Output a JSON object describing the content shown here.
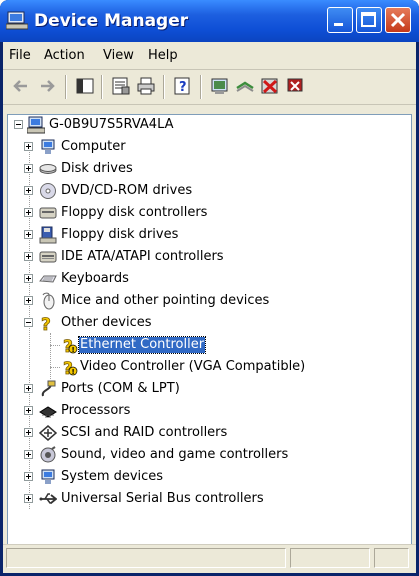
{
  "window": {
    "title": "Device Manager"
  },
  "menu": {
    "file": "File",
    "action": "Action",
    "view": "View",
    "help": "Help"
  },
  "toolbar": {
    "icons": [
      "back-arrow-icon",
      "forward-arrow-icon",
      "console-tree-icon",
      "properties-icon",
      "print-icon",
      "help-icon",
      "scan-hardware-icon",
      "update-driver-icon",
      "disable-device-icon",
      "uninstall-device-icon"
    ]
  },
  "tree": {
    "root": "G-0B9U7S5RVA4LA",
    "items": [
      {
        "label": "Computer",
        "icon": "computer-icon",
        "expanded": false
      },
      {
        "label": "Disk drives",
        "icon": "disk-drive-icon",
        "expanded": false
      },
      {
        "label": "DVD/CD-ROM drives",
        "icon": "cdrom-icon",
        "expanded": false
      },
      {
        "label": "Floppy disk controllers",
        "icon": "floppy-controller-icon",
        "expanded": false
      },
      {
        "label": "Floppy disk drives",
        "icon": "floppy-drive-icon",
        "expanded": false
      },
      {
        "label": "IDE ATA/ATAPI controllers",
        "icon": "ide-controller-icon",
        "expanded": false
      },
      {
        "label": "Keyboards",
        "icon": "keyboard-icon",
        "expanded": false
      },
      {
        "label": "Mice and other pointing devices",
        "icon": "mouse-icon",
        "expanded": false
      },
      {
        "label": "Other devices",
        "icon": "unknown-device-icon",
        "expanded": true
      },
      {
        "label": "Ports (COM & LPT)",
        "icon": "port-icon",
        "expanded": false
      },
      {
        "label": "Processors",
        "icon": "processor-icon",
        "expanded": false
      },
      {
        "label": "SCSI and RAID controllers",
        "icon": "scsi-icon",
        "expanded": false
      },
      {
        "label": "Sound, video and game controllers",
        "icon": "sound-icon",
        "expanded": false
      },
      {
        "label": "System devices",
        "icon": "system-device-icon",
        "expanded": false
      },
      {
        "label": "Universal Serial Bus controllers",
        "icon": "usb-icon",
        "expanded": false
      }
    ],
    "other_devices_children": [
      {
        "label": "Ethernet Controller",
        "icon": "unknown-device-warning-icon",
        "selected": true
      },
      {
        "label": "Video Controller (VGA Compatible)",
        "icon": "unknown-device-warning-icon",
        "selected": false
      }
    ]
  },
  "colors": {
    "titlebar": "#0e4fd6",
    "selection": "#316ac5",
    "frame": "#ece9d8"
  }
}
